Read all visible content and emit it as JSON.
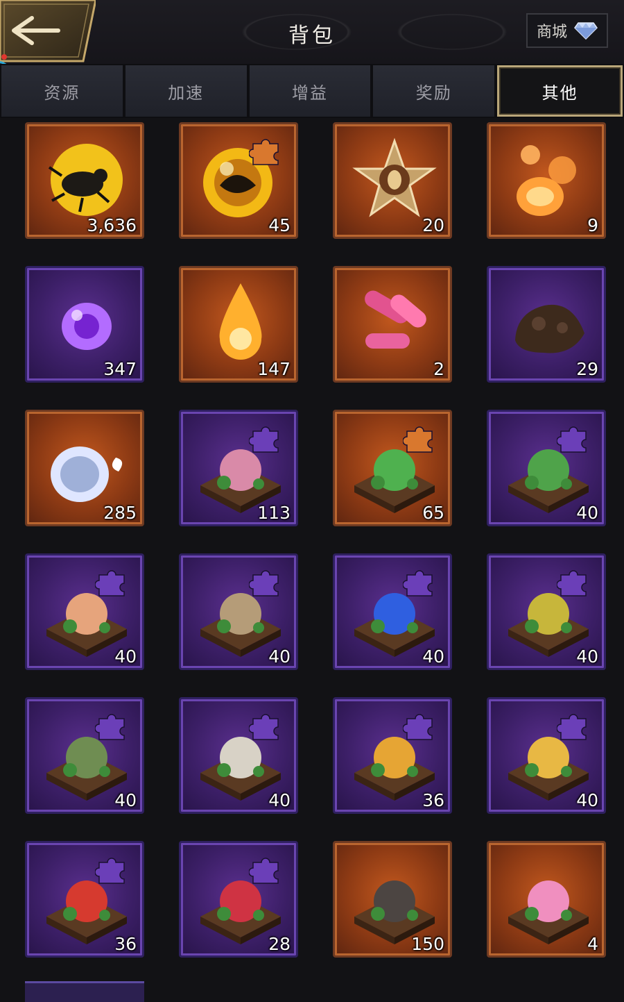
{
  "header": {
    "back_icon": "back-arrow-icon",
    "title": "背包",
    "shop_label": "商城",
    "shop_icon": "diamond-icon"
  },
  "tabs": [
    {
      "label": "资源",
      "active": false
    },
    {
      "label": "加速",
      "active": false
    },
    {
      "label": "增益",
      "active": false
    },
    {
      "label": "奖励",
      "active": false
    },
    {
      "label": "其他",
      "active": true
    }
  ],
  "colors": {
    "orange_tile": "#8d3a14",
    "purple_tile": "#3c1f67",
    "active_tab_border": "#b9a679",
    "puzzle_purple": "#6b3fb8",
    "puzzle_orange": "#d9782e"
  },
  "items": [
    {
      "icon": "beetle-in-amber-icon",
      "count": "3,636",
      "rarity": "orange",
      "puzzle": false
    },
    {
      "icon": "amber-orb-icon",
      "count": "45",
      "rarity": "orange",
      "puzzle": true
    },
    {
      "icon": "beetle-star-badge-icon",
      "count": "20",
      "rarity": "orange",
      "puzzle": false
    },
    {
      "icon": "amber-droplets-icon",
      "count": "9",
      "rarity": "orange",
      "puzzle": false
    },
    {
      "icon": "purple-gel-icon",
      "count": "347",
      "rarity": "purple",
      "puzzle": false
    },
    {
      "icon": "honey-drop-icon",
      "count": "147",
      "rarity": "orange",
      "puzzle": false
    },
    {
      "icon": "pink-bacteria-icon",
      "count": "2",
      "rarity": "orange",
      "puzzle": false
    },
    {
      "icon": "soil-clump-icon",
      "count": "29",
      "rarity": "purple",
      "puzzle": false
    },
    {
      "icon": "dew-drop-icon",
      "count": "285",
      "rarity": "orange",
      "puzzle": false
    },
    {
      "icon": "succulent-tile-icon",
      "count": "113",
      "rarity": "purple",
      "puzzle": true
    },
    {
      "icon": "clover-rock-tile-icon",
      "count": "65",
      "rarity": "orange",
      "puzzle": true
    },
    {
      "icon": "watermelon-tile-icon",
      "count": "40",
      "rarity": "purple",
      "puzzle": true
    },
    {
      "icon": "seashell-tile-icon",
      "count": "40",
      "rarity": "purple",
      "puzzle": true
    },
    {
      "icon": "fossil-tile-icon",
      "count": "40",
      "rarity": "purple",
      "puzzle": true
    },
    {
      "icon": "blue-crayfish-tile-icon",
      "count": "40",
      "rarity": "purple",
      "puzzle": true
    },
    {
      "icon": "banana-plant-tile-icon",
      "count": "40",
      "rarity": "purple",
      "puzzle": true
    },
    {
      "icon": "moss-stone-tile-icon",
      "count": "40",
      "rarity": "purple",
      "puzzle": true
    },
    {
      "icon": "skull-tile-icon",
      "count": "40",
      "rarity": "purple",
      "puzzle": true
    },
    {
      "icon": "pineapple-tile-icon",
      "count": "36",
      "rarity": "purple",
      "puzzle": true
    },
    {
      "icon": "sponge-shell-tile-icon",
      "count": "40",
      "rarity": "purple",
      "puzzle": true
    },
    {
      "icon": "coral-rock-tile-icon",
      "count": "36",
      "rarity": "purple",
      "puzzle": true
    },
    {
      "icon": "rafflesia-tile-icon",
      "count": "28",
      "rarity": "purple",
      "puzzle": true
    },
    {
      "icon": "rock-pile-icon",
      "count": "150",
      "rarity": "orange",
      "puzzle": false
    },
    {
      "icon": "lily-tile-icon",
      "count": "4",
      "rarity": "orange",
      "puzzle": false
    }
  ]
}
